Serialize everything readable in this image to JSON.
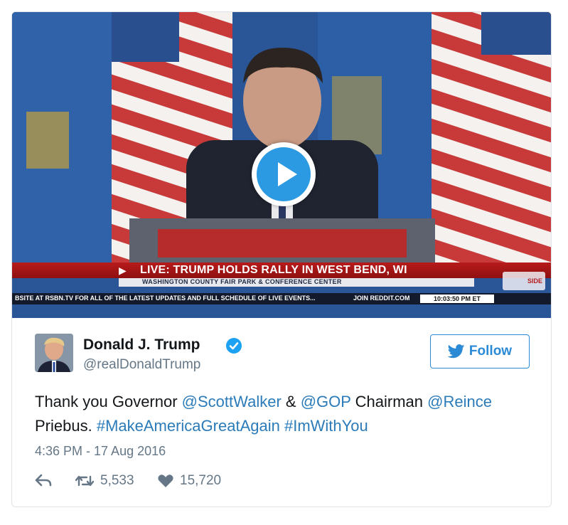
{
  "video": {
    "overlay": {
      "headline": "LIVE: TRUMP HOLDS RALLY IN WEST BEND, WI",
      "subline": "WASHINGTON COUNTY FAIR PARK & CONFERENCE CENTER",
      "ticker": "BSITE AT RSBN.TV FOR ALL OF THE LATEST UPDATES AND FULL SCHEDULE OF LIVE EVENTS...",
      "ticker_right": "JOIN REDDIT.COM",
      "clock": "10:03:50 PM ET",
      "logo_text": "SIDE"
    },
    "play_icon": "play-icon"
  },
  "author": {
    "name": "Donald J. Trump",
    "handle": "@realDonaldTrump",
    "verified_icon": "verified-badge-icon"
  },
  "follow": {
    "label": "Follow",
    "icon": "twitter-bird-icon"
  },
  "tweet": {
    "segments": [
      {
        "text": "Thank you Governor ",
        "link": false
      },
      {
        "text": "@ScottWalker",
        "link": true
      },
      {
        "text": " & ",
        "link": false
      },
      {
        "text": "@GOP",
        "link": true
      },
      {
        "text": " Chairman ",
        "link": false
      },
      {
        "text": "@Reince",
        "link": true
      },
      {
        "text": " Priebus. ",
        "link": false
      },
      {
        "text": "#MakeAmericaGreatAgain",
        "link": true
      },
      {
        "text": " ",
        "link": false
      },
      {
        "text": "#ImWithYou",
        "link": true
      }
    ],
    "timestamp": "4:36 PM - 17 Aug 2016"
  },
  "actions": {
    "reply_icon": "reply-icon",
    "retweet_icon": "retweet-icon",
    "retweets": "5,533",
    "like_icon": "heart-icon",
    "likes": "15,720"
  },
  "colors": {
    "link": "#2b7bb9",
    "follow": "#2b8ad6",
    "verified": "#1da1f2",
    "play": "#2c9ae3",
    "muted": "#657786"
  }
}
